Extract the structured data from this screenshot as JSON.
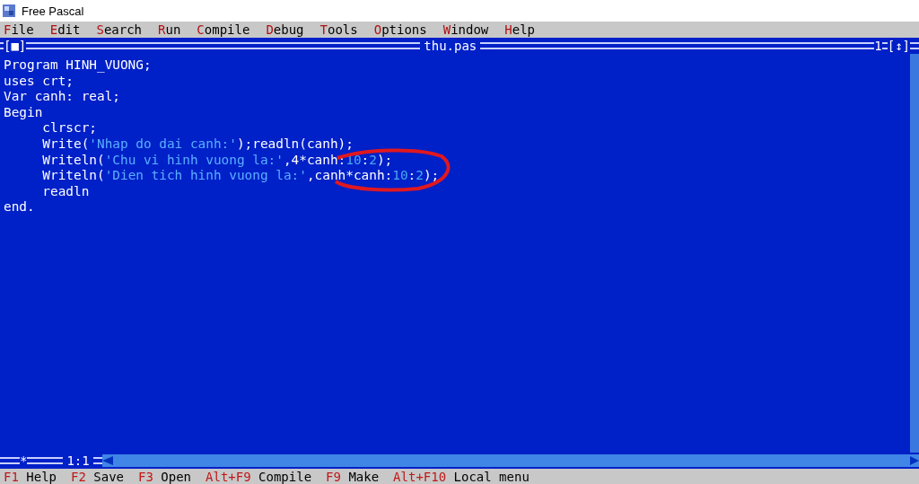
{
  "window": {
    "title": "Free Pascal"
  },
  "menu": [
    {
      "hotkey": "F",
      "rest": "ile"
    },
    {
      "hotkey": "E",
      "rest": "dit"
    },
    {
      "hotkey": "S",
      "rest": "earch"
    },
    {
      "hotkey": "R",
      "rest": "un"
    },
    {
      "hotkey": "C",
      "rest": "ompile"
    },
    {
      "hotkey": "D",
      "rest": "ebug"
    },
    {
      "hotkey": "T",
      "rest": "ools"
    },
    {
      "hotkey": "O",
      "rest": "ptions"
    },
    {
      "hotkey": "W",
      "rest": "indow"
    },
    {
      "hotkey": "H",
      "rest": "elp"
    }
  ],
  "editor": {
    "close_box": "[■]",
    "title": "thu.pas",
    "window_number": "1",
    "zoom_box": "[↕]",
    "modified": "*",
    "position": "1:1",
    "lines": [
      [
        {
          "kind": "code",
          "text": "Program HINH_VUONG;"
        }
      ],
      [
        {
          "kind": "code",
          "text": "uses crt;"
        }
      ],
      [
        {
          "kind": "code",
          "text": "Var canh: real;"
        }
      ],
      [
        {
          "kind": "code",
          "text": "Begin"
        }
      ],
      [
        {
          "kind": "code",
          "text": "     clrscr;"
        }
      ],
      [
        {
          "kind": "code",
          "text": "     Write("
        },
        {
          "kind": "string",
          "text": "'Nhap do dai canh:'"
        },
        {
          "kind": "code",
          "text": ");readln(canh);"
        }
      ],
      [
        {
          "kind": "code",
          "text": "     Writeln("
        },
        {
          "kind": "string",
          "text": "'Chu vi hinh vuong la:'"
        },
        {
          "kind": "code",
          "text": ",4*canh:"
        },
        {
          "kind": "number",
          "text": "10"
        },
        {
          "kind": "code",
          "text": ":"
        },
        {
          "kind": "number",
          "text": "2"
        },
        {
          "kind": "code",
          "text": ");"
        }
      ],
      [
        {
          "kind": "code",
          "text": "     Writeln("
        },
        {
          "kind": "string",
          "text": "'Dien tich hinh vuong la:'"
        },
        {
          "kind": "code",
          "text": ",canh*canh:"
        },
        {
          "kind": "number",
          "text": "10"
        },
        {
          "kind": "code",
          "text": ":"
        },
        {
          "kind": "number",
          "text": "2"
        },
        {
          "kind": "code",
          "text": ");"
        }
      ],
      [
        {
          "kind": "code",
          "text": "     readln"
        }
      ],
      [
        {
          "kind": "code",
          "text": "end."
        }
      ]
    ]
  },
  "status_bar": [
    {
      "key": "F1",
      "label": "Help"
    },
    {
      "key": "F2",
      "label": "Save"
    },
    {
      "key": "F3",
      "label": "Open"
    },
    {
      "key": "Alt+F9",
      "label": "Compile"
    },
    {
      "key": "F9",
      "label": "Make"
    },
    {
      "key": "Alt+F10",
      "label": "Local menu"
    }
  ]
}
